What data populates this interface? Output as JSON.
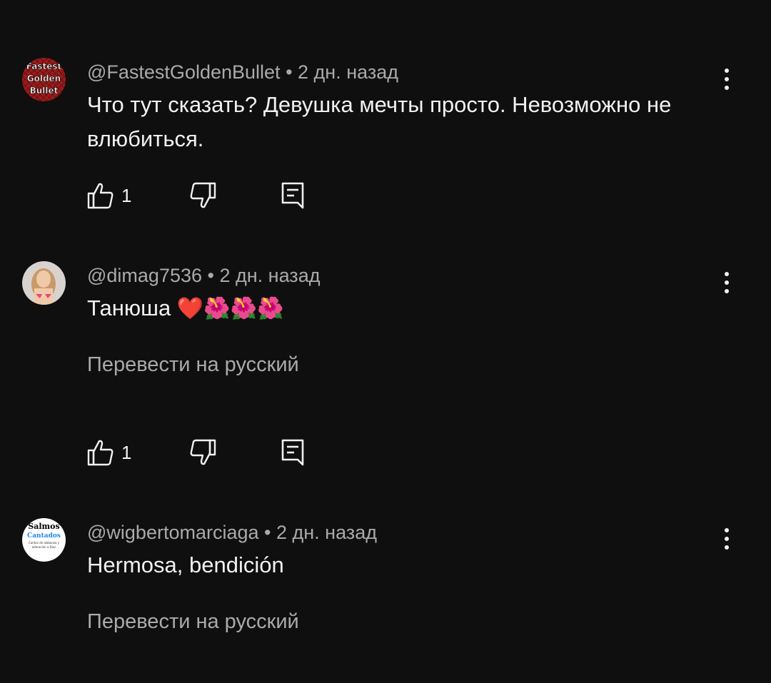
{
  "comments": [
    {
      "author": "@FastestGoldenBullet",
      "time": "2 дн. назад",
      "text": "Что тут сказать? Девушка мечты просто. Невозможно не влюбиться.",
      "likes": "1",
      "avatar_lines": [
        "Fastest",
        "Golden",
        "Bullet"
      ]
    },
    {
      "author": "@dimag7536",
      "time": "2 дн. назад",
      "text": "Танюша",
      "emoji": "❤️🌺🌺🌺",
      "translate": "Перевести на русский",
      "likes": "1"
    },
    {
      "author": "@wigbertomarciaga",
      "time": "2 дн. назад",
      "text": "Hermosa, bendición",
      "translate": "Перевести на русский",
      "avatar_lines": [
        "Salmos",
        "Cantados",
        "Cantos de alabanza y",
        "adoración a Dios"
      ]
    }
  ],
  "separator": "•",
  "icons": {
    "like": "thumb-up-icon",
    "dislike": "thumb-down-icon",
    "reply": "reply-comment-icon",
    "menu": "more-vertical-icon"
  }
}
